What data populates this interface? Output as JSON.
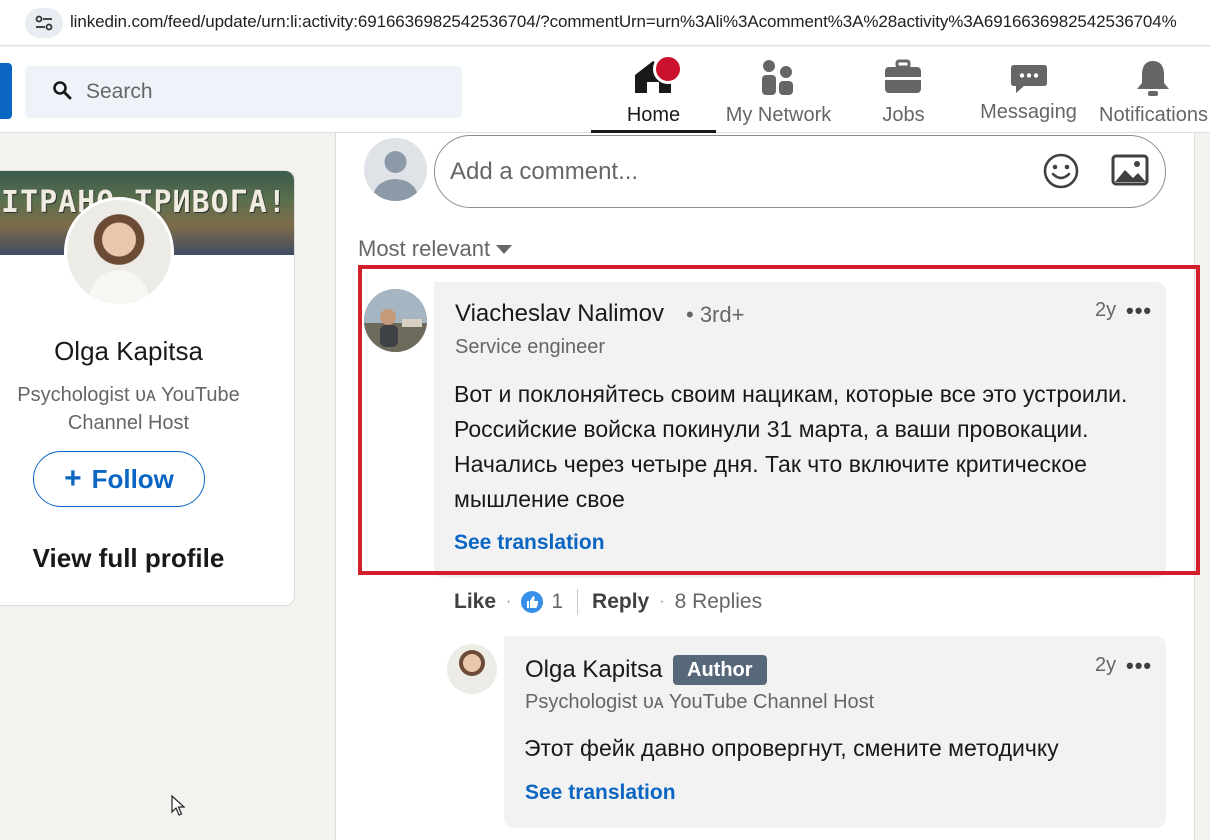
{
  "browser": {
    "url": "linkedin.com/feed/update/urn:li:activity:6916636982542536704/?commentUrn=urn%3Ali%3Acomment%3A%28activity%3A6916636982542536704%"
  },
  "nav": {
    "search_placeholder": "Search",
    "items": [
      {
        "label": "Home",
        "icon": "home-icon",
        "active": true
      },
      {
        "label": "My Network",
        "icon": "network-icon"
      },
      {
        "label": "Jobs",
        "icon": "briefcase-icon"
      },
      {
        "label": "Messaging",
        "icon": "chat-icon"
      },
      {
        "label": "Notifications",
        "icon": "bell-icon"
      }
    ]
  },
  "profile_card": {
    "banner_text": "ІТРАНО ТРИВОГА!",
    "name": "Olga Kapitsa",
    "headline": "Psychologist ᴜᴀ YouTube Channel Host",
    "follow_label": "Follow",
    "view_profile_label": "View full profile"
  },
  "comment_input": {
    "placeholder": "Add a comment..."
  },
  "sort": {
    "label": "Most relevant"
  },
  "comments": [
    {
      "author": "Viacheslav Nalimov",
      "degree": "• 3rd+",
      "subtitle": "Service engineer",
      "time": "2y",
      "more": "•••",
      "text": "Вот и поклоняйтесь своим нацикам, которые все это устроили. Российские войска покинули 31 марта, а ваши провокации. Начались через четыре дня. Так что включите критическое мышление свое",
      "translate_label": "See translation",
      "actions": {
        "like": "Like",
        "like_count": "1",
        "reply": "Reply",
        "replies": "8 Replies"
      }
    },
    {
      "author": "Olga Kapitsa",
      "tag": "Author",
      "subtitle": "Psychologist ᴜᴀ YouTube Channel Host",
      "time": "2y",
      "more": "•••",
      "text": "Этот фейк давно опровергнут, смените методичку",
      "translate_label": "See translation"
    }
  ],
  "colors": {
    "brand_blue": "#0a66c2",
    "highlight_red": "#d2202a",
    "notification_red": "#cb112d",
    "author_tag": "#56687a"
  }
}
